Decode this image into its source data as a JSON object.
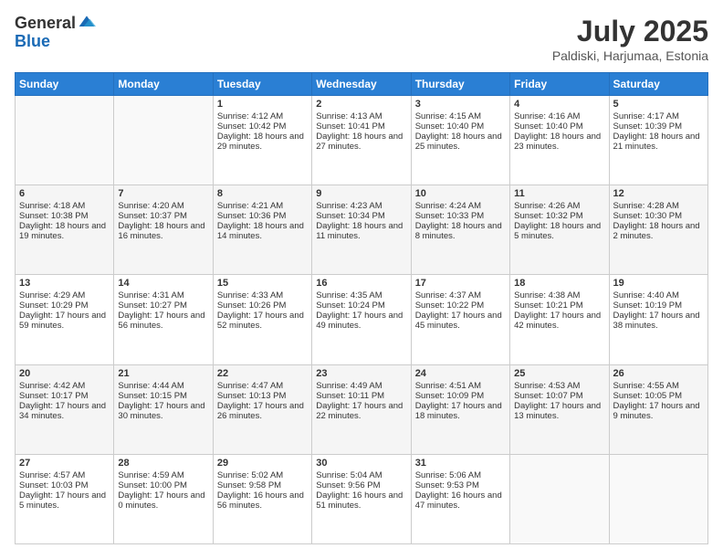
{
  "logo": {
    "general": "General",
    "blue": "Blue"
  },
  "title": "July 2025",
  "subtitle": "Paldiski, Harjumaa, Estonia",
  "headers": [
    "Sunday",
    "Monday",
    "Tuesday",
    "Wednesday",
    "Thursday",
    "Friday",
    "Saturday"
  ],
  "weeks": [
    [
      {
        "day": "",
        "content": ""
      },
      {
        "day": "",
        "content": ""
      },
      {
        "day": "1",
        "content": "Sunrise: 4:12 AM\nSunset: 10:42 PM\nDaylight: 18 hours and 29 minutes."
      },
      {
        "day": "2",
        "content": "Sunrise: 4:13 AM\nSunset: 10:41 PM\nDaylight: 18 hours and 27 minutes."
      },
      {
        "day": "3",
        "content": "Sunrise: 4:15 AM\nSunset: 10:40 PM\nDaylight: 18 hours and 25 minutes."
      },
      {
        "day": "4",
        "content": "Sunrise: 4:16 AM\nSunset: 10:40 PM\nDaylight: 18 hours and 23 minutes."
      },
      {
        "day": "5",
        "content": "Sunrise: 4:17 AM\nSunset: 10:39 PM\nDaylight: 18 hours and 21 minutes."
      }
    ],
    [
      {
        "day": "6",
        "content": "Sunrise: 4:18 AM\nSunset: 10:38 PM\nDaylight: 18 hours and 19 minutes."
      },
      {
        "day": "7",
        "content": "Sunrise: 4:20 AM\nSunset: 10:37 PM\nDaylight: 18 hours and 16 minutes."
      },
      {
        "day": "8",
        "content": "Sunrise: 4:21 AM\nSunset: 10:36 PM\nDaylight: 18 hours and 14 minutes."
      },
      {
        "day": "9",
        "content": "Sunrise: 4:23 AM\nSunset: 10:34 PM\nDaylight: 18 hours and 11 minutes."
      },
      {
        "day": "10",
        "content": "Sunrise: 4:24 AM\nSunset: 10:33 PM\nDaylight: 18 hours and 8 minutes."
      },
      {
        "day": "11",
        "content": "Sunrise: 4:26 AM\nSunset: 10:32 PM\nDaylight: 18 hours and 5 minutes."
      },
      {
        "day": "12",
        "content": "Sunrise: 4:28 AM\nSunset: 10:30 PM\nDaylight: 18 hours and 2 minutes."
      }
    ],
    [
      {
        "day": "13",
        "content": "Sunrise: 4:29 AM\nSunset: 10:29 PM\nDaylight: 17 hours and 59 minutes."
      },
      {
        "day": "14",
        "content": "Sunrise: 4:31 AM\nSunset: 10:27 PM\nDaylight: 17 hours and 56 minutes."
      },
      {
        "day": "15",
        "content": "Sunrise: 4:33 AM\nSunset: 10:26 PM\nDaylight: 17 hours and 52 minutes."
      },
      {
        "day": "16",
        "content": "Sunrise: 4:35 AM\nSunset: 10:24 PM\nDaylight: 17 hours and 49 minutes."
      },
      {
        "day": "17",
        "content": "Sunrise: 4:37 AM\nSunset: 10:22 PM\nDaylight: 17 hours and 45 minutes."
      },
      {
        "day": "18",
        "content": "Sunrise: 4:38 AM\nSunset: 10:21 PM\nDaylight: 17 hours and 42 minutes."
      },
      {
        "day": "19",
        "content": "Sunrise: 4:40 AM\nSunset: 10:19 PM\nDaylight: 17 hours and 38 minutes."
      }
    ],
    [
      {
        "day": "20",
        "content": "Sunrise: 4:42 AM\nSunset: 10:17 PM\nDaylight: 17 hours and 34 minutes."
      },
      {
        "day": "21",
        "content": "Sunrise: 4:44 AM\nSunset: 10:15 PM\nDaylight: 17 hours and 30 minutes."
      },
      {
        "day": "22",
        "content": "Sunrise: 4:47 AM\nSunset: 10:13 PM\nDaylight: 17 hours and 26 minutes."
      },
      {
        "day": "23",
        "content": "Sunrise: 4:49 AM\nSunset: 10:11 PM\nDaylight: 17 hours and 22 minutes."
      },
      {
        "day": "24",
        "content": "Sunrise: 4:51 AM\nSunset: 10:09 PM\nDaylight: 17 hours and 18 minutes."
      },
      {
        "day": "25",
        "content": "Sunrise: 4:53 AM\nSunset: 10:07 PM\nDaylight: 17 hours and 13 minutes."
      },
      {
        "day": "26",
        "content": "Sunrise: 4:55 AM\nSunset: 10:05 PM\nDaylight: 17 hours and 9 minutes."
      }
    ],
    [
      {
        "day": "27",
        "content": "Sunrise: 4:57 AM\nSunset: 10:03 PM\nDaylight: 17 hours and 5 minutes."
      },
      {
        "day": "28",
        "content": "Sunrise: 4:59 AM\nSunset: 10:00 PM\nDaylight: 17 hours and 0 minutes."
      },
      {
        "day": "29",
        "content": "Sunrise: 5:02 AM\nSunset: 9:58 PM\nDaylight: 16 hours and 56 minutes."
      },
      {
        "day": "30",
        "content": "Sunrise: 5:04 AM\nSunset: 9:56 PM\nDaylight: 16 hours and 51 minutes."
      },
      {
        "day": "31",
        "content": "Sunrise: 5:06 AM\nSunset: 9:53 PM\nDaylight: 16 hours and 47 minutes."
      },
      {
        "day": "",
        "content": ""
      },
      {
        "day": "",
        "content": ""
      }
    ]
  ]
}
